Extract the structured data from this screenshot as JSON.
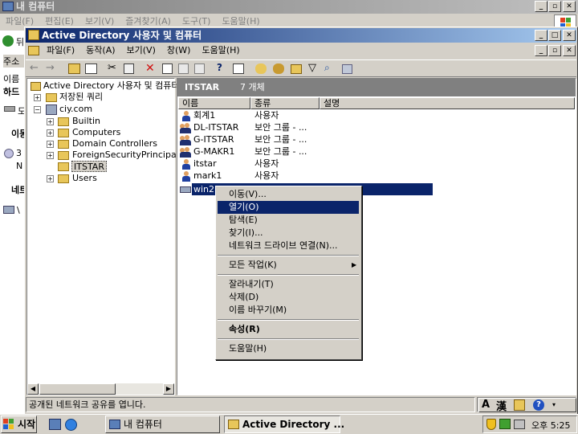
{
  "outer_window": {
    "title": "내 컴퓨터",
    "menu": [
      "파일(F)",
      "편집(E)",
      "보기(V)",
      "즐겨찾기(A)",
      "도구(T)",
      "도움말(H)"
    ],
    "left_fragments": [
      "뒤",
      "주소",
      "이름",
      "하드",
      "도",
      "이동",
      "3",
      "N",
      "네트",
      "\\"
    ]
  },
  "mmc": {
    "title": "Active Directory 사용자 및 컴퓨터",
    "menu": [
      "파일(F)",
      "동작(A)",
      "보기(V)",
      "창(W)",
      "도움말(H)"
    ],
    "tree": {
      "root": "Active Directory 사용자 및 컴퓨터",
      "saved_queries": "저장된 쿼리",
      "domain": "ciy.com",
      "children": [
        "Builtin",
        "Computers",
        "Domain Controllers",
        "ForeignSecurityPrincipals",
        "ITSTAR",
        "Users"
      ]
    },
    "pane_header": {
      "title": "ITSTAR",
      "count": "7 개체"
    },
    "columns": [
      "이름",
      "종류",
      "설명"
    ],
    "rows": [
      {
        "name": "회계1",
        "type": "사용자",
        "icon": "user-icon"
      },
      {
        "name": "DL-ITSTAR",
        "type": "보안 그룹 - ...",
        "icon": "group-icon"
      },
      {
        "name": "G-ITSTAR",
        "type": "보안 그룹 - ...",
        "icon": "group-icon"
      },
      {
        "name": "G-MAKR1",
        "type": "보안 그룹 - ...",
        "icon": "group-icon"
      },
      {
        "name": "itstar",
        "type": "사용자",
        "icon": "user-icon"
      },
      {
        "name": "mark1",
        "type": "사용자",
        "icon": "user-icon"
      },
      {
        "name": "win2",
        "type": "",
        "icon": "share-icon"
      }
    ],
    "status": "공개된 네트워크 공유를 엽니다."
  },
  "context_menu": {
    "items": [
      {
        "label": "이동(V)...",
        "selected": false
      },
      {
        "label": "열기(O)",
        "selected": true
      },
      {
        "label": "탐색(E)",
        "selected": false
      },
      {
        "label": "찾기(I)...",
        "selected": false
      },
      {
        "label": "네트워크 드라이브 연결(N)...",
        "selected": false
      },
      {
        "label": "모든 작업(K)",
        "submenu": true
      },
      {
        "label": "잘라내기(T)"
      },
      {
        "label": "삭제(D)"
      },
      {
        "label": "이름 바꾸기(M)"
      },
      {
        "label": "속성(R)",
        "bold": true
      },
      {
        "label": "도움말(H)"
      }
    ]
  },
  "taskbar": {
    "start": "시작",
    "tasks": [
      "내 컴퓨터",
      "Active Directory ..."
    ],
    "clock": "오후 5:25"
  },
  "language_bar": {
    "a": "A",
    "han": "漢"
  },
  "colors": {
    "title_active": "#0a246a",
    "title_gradient_end": "#a6caf0",
    "face": "#d4d0c8",
    "header_gray": "#808080"
  }
}
